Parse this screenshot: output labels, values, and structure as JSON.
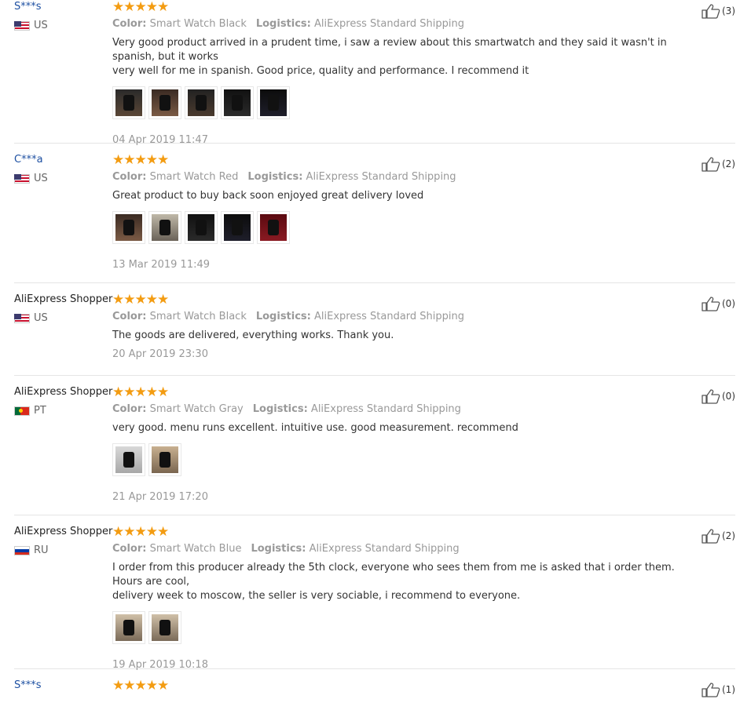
{
  "reviews": [
    {
      "name": "S***s",
      "name_style": "link",
      "country": "US",
      "flag": "us",
      "stars": "★★★★★",
      "color_label": "Color:",
      "color_value": "Smart Watch Black",
      "logistics_label": "Logistics:",
      "logistics_value": "AliExpress Standard Shipping",
      "text_lines": [
        "Very good product arrived in a prudent time, i saw a review about this smartwatch and they said it wasn't in spanish, but it works",
        "very well for me in spanish. Good price, quality and performance. I recommend it"
      ],
      "photo_count": 5,
      "date": "04 Apr 2019 11:47",
      "useful_count": "(3)"
    },
    {
      "name": "C***a",
      "name_style": "link",
      "country": "US",
      "flag": "us",
      "stars": "★★★★★",
      "color_label": "Color:",
      "color_value": "Smart Watch Red",
      "logistics_label": "Logistics:",
      "logistics_value": "AliExpress Standard Shipping",
      "text_lines": [
        "Great product to buy back soon enjoyed great delivery loved"
      ],
      "photo_count": 5,
      "date": "13 Mar 2019 11:49",
      "useful_count": "(2)"
    },
    {
      "name": "AliExpress Shopper",
      "name_style": "plain",
      "country": "US",
      "flag": "us",
      "stars": "★★★★★",
      "color_label": "Color:",
      "color_value": "Smart Watch Black",
      "logistics_label": "Logistics:",
      "logistics_value": "AliExpress Standard Shipping",
      "text_lines": [
        "The goods are delivered, everything works. Thank you."
      ],
      "photo_count": 0,
      "date": "20 Apr 2019 23:30",
      "useful_count": "(0)"
    },
    {
      "name": "AliExpress Shopper",
      "name_style": "plain",
      "country": "PT",
      "flag": "pt",
      "stars": "★★★★★",
      "color_label": "Color:",
      "color_value": "Smart Watch Gray",
      "logistics_label": "Logistics:",
      "logistics_value": "AliExpress Standard Shipping",
      "text_lines": [
        "very good. menu runs excellent. intuitive use. good measurement. recommend"
      ],
      "photo_count": 2,
      "date": "21 Apr 2019 17:20",
      "useful_count": "(0)"
    },
    {
      "name": "AliExpress Shopper",
      "name_style": "plain",
      "country": "RU",
      "flag": "ru",
      "stars": "★★★★★",
      "color_label": "Color:",
      "color_value": "Smart Watch Blue",
      "logistics_label": "Logistics:",
      "logistics_value": "AliExpress Standard Shipping",
      "text_lines": [
        "I order from this producer already the 5th clock, everyone who sees them from me is asked that i order them. Hours are cool,",
        "delivery week to moscow, the seller is very sociable, i recommend to everyone."
      ],
      "photo_count": 2,
      "date": "19 Apr 2019 10:18",
      "useful_count": "(2)"
    },
    {
      "name": "S***s",
      "name_style": "link",
      "country": "",
      "flag": "",
      "stars": "★★★★★",
      "color_label": "",
      "color_value": "",
      "logistics_label": "",
      "logistics_value": "",
      "text_lines": [],
      "photo_count": 0,
      "date": "",
      "useful_count": "(1)"
    }
  ],
  "icons": {
    "thumb": "thumbs-up-icon",
    "star": "star-icon"
  },
  "colors": {
    "star": "#f39c12",
    "link": "#1e50a2",
    "meta": "#999999"
  }
}
